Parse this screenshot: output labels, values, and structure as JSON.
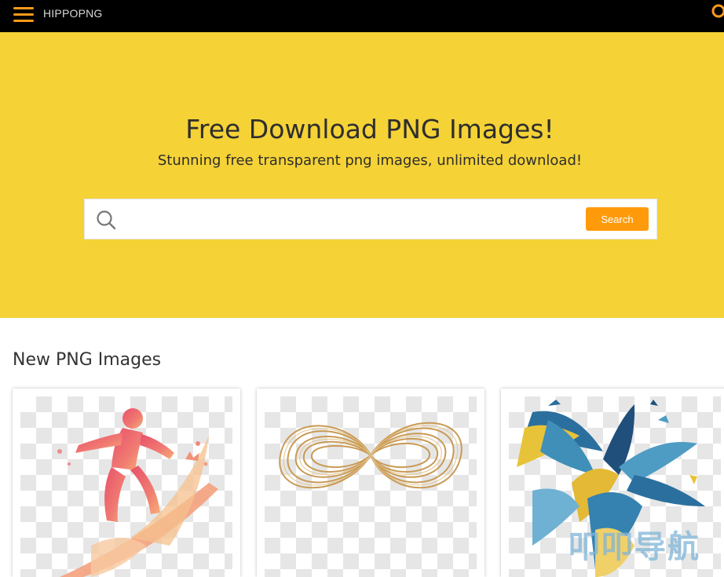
{
  "header": {
    "logo_text": "HIPPOPNG",
    "menu_icon": "hamburger-icon",
    "search_icon": "search-icon",
    "accent_color": "#ff9a1a",
    "background_color": "#000000"
  },
  "hero": {
    "title": "Free Download PNG Images!",
    "subtitle": "Stunning free transparent png images, unlimited download!",
    "background_color": "#f5d236",
    "search": {
      "placeholder": "",
      "value": "",
      "button_label": "Search",
      "button_color": "#ff9b0b"
    }
  },
  "section": {
    "title": "New PNG Images",
    "cards": [
      {
        "alt": "Surfer silhouette with colorful splash"
      },
      {
        "alt": "Gold infinity symbol"
      },
      {
        "alt": "Blue and yellow paint splash tropical leaves"
      }
    ]
  },
  "watermark": {
    "text": "叩叩导航"
  }
}
